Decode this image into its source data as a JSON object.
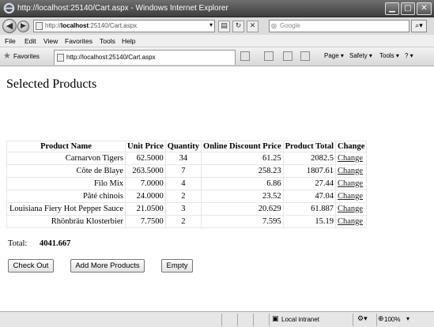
{
  "window": {
    "title": "http://localhost:25140/Cart.aspx - Windows Internet Explorer",
    "min_glyph": "▁",
    "max_glyph": "□",
    "close_glyph": "✕"
  },
  "address": {
    "url_prefix": "http://",
    "url_host": "localhost",
    "url_rest": ":25140/Cart.aspx",
    "search_placeholder": "Google"
  },
  "menu": [
    "File",
    "Edit",
    "View",
    "Favorites",
    "Tools",
    "Help"
  ],
  "favorites": {
    "label": "Favorites",
    "tab_title": "http://localhost:25140/Cart.aspx"
  },
  "commands": {
    "page": "Page ▾",
    "safety": "Safety ▾",
    "tools": "Tools ▾",
    "help": "? ▾"
  },
  "page": {
    "title": "Selected Products",
    "table": {
      "headers": [
        "Product Name",
        "Unit Price",
        "Quantity",
        "Online Discount Price",
        "Product Total",
        "Change"
      ],
      "rows": [
        [
          "Carnarvon Tigers",
          "62.5000",
          "34",
          "61.25",
          "2082.5",
          "Change"
        ],
        [
          "Côte de Blaye",
          "263.5000",
          "7",
          "258.23",
          "1807.61",
          "Change"
        ],
        [
          "Filo Mix",
          "7.0000",
          "4",
          "6.86",
          "27.44",
          "Change"
        ],
        [
          "Pâté chinois",
          "24.0000",
          "2",
          "23.52",
          "47.04",
          "Change"
        ],
        [
          "Louisiana Fiery Hot Pepper Sauce",
          "21.0500",
          "3",
          "20.629",
          "61.887",
          "Change"
        ],
        [
          "Rhönbräu Klosterbier",
          "7.7500",
          "2",
          "7.595",
          "15.19",
          "Change"
        ]
      ]
    },
    "total_label": "Total:",
    "total_value": "4041.667",
    "buttons": {
      "checkout": "Check Out",
      "add_more": "Add More Products",
      "empty": "Empty"
    }
  },
  "status": {
    "zone": "Local intranet",
    "zoom": "100%"
  }
}
